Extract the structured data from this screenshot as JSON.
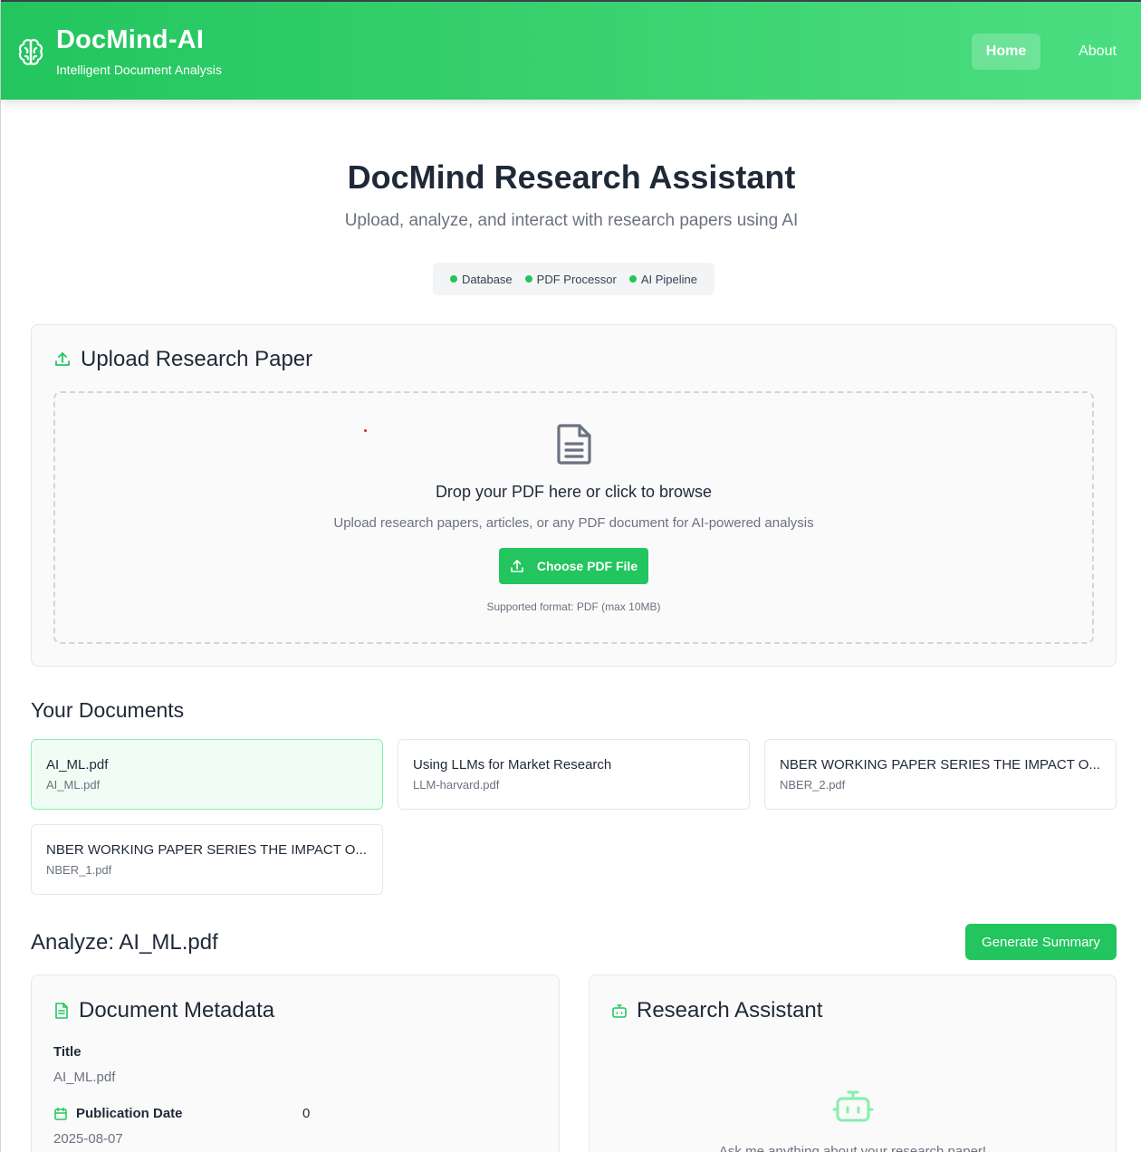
{
  "app": {
    "title": "DocMind-AI",
    "subtitle": "Intelligent Document Analysis",
    "brand_icon": "brain-icon"
  },
  "nav": {
    "home": "Home",
    "about": "About"
  },
  "hero": {
    "title": "DocMind Research Assistant",
    "subtitle": "Upload, analyze, and interact with research papers using AI",
    "status": [
      {
        "label": "Database",
        "color": "#22c55e"
      },
      {
        "label": "PDF Processor",
        "color": "#22c55e"
      },
      {
        "label": "AI Pipeline",
        "color": "#22c55e"
      }
    ]
  },
  "upload": {
    "title": "Upload Research Paper",
    "drop_title": "Drop your PDF here or click to browse",
    "drop_sub": "Upload research papers, articles, or any PDF document for AI-powered analysis",
    "button": "Choose PDF File",
    "note": "Supported format: PDF (max 10MB)"
  },
  "documents": {
    "heading": "Your Documents",
    "items": [
      {
        "name": "AI_ML.pdf",
        "file": "AI_ML.pdf",
        "active": true
      },
      {
        "name": "Using LLMs for Market Research",
        "file": "LLM-harvard.pdf",
        "active": false
      },
      {
        "name": "NBER WORKING PAPER SERIES THE IMPACT O...",
        "file": "NBER_2.pdf",
        "active": false
      },
      {
        "name": "NBER WORKING PAPER SERIES THE IMPACT O...",
        "file": "NBER_1.pdf",
        "active": false
      }
    ]
  },
  "analyze": {
    "title": "Analyze: AI_ML.pdf",
    "generate_button": "Generate Summary"
  },
  "metadata": {
    "title": "Document Metadata",
    "title_label": "Title",
    "title_value": "AI_ML.pdf",
    "date_label": "Publication Date",
    "date_value": "2025-08-07",
    "side_value": "0"
  },
  "assistant": {
    "title": "Research Assistant",
    "prompt": "Ask me anything about your research paper!"
  },
  "colors": {
    "accent": "#22c55e",
    "header_gradient_end": "#4ade80"
  }
}
